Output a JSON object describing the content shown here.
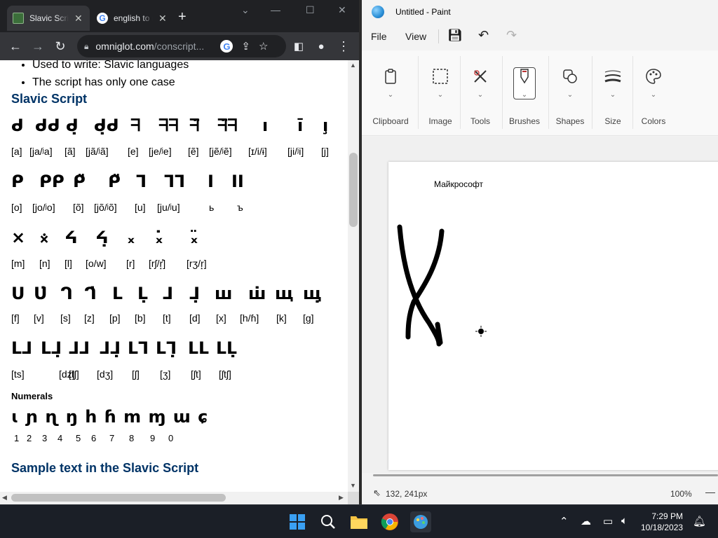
{
  "chrome": {
    "tabs": [
      {
        "label": "Slavic Script",
        "active": true
      },
      {
        "label": "english to russian",
        "active": false
      }
    ],
    "new_tab": "+",
    "window_controls": {
      "minimize": "—",
      "maximize": "☐",
      "close": "✕"
    },
    "url_domain": "omniglot.com",
    "url_path": "/conscript...",
    "icons": [
      "back-icon",
      "forward-icon",
      "reload-icon",
      "lock-icon",
      "google-icon",
      "share-icon",
      "star-icon",
      "sidepanel-icon",
      "profile-icon",
      "menu-icon"
    ]
  },
  "page": {
    "bullets": [
      "Used to write: Slavic languages",
      "The script has only one case"
    ],
    "heading_slavic": "Slavic Script",
    "rows": [
      {
        "glyphs": [
          "ᑯ",
          "ᑯᑯ",
          "ᑯ̣",
          "ᑯ̣ᑯ",
          "ᖷ",
          "ᖷᖷ",
          "ᖷ̈",
          "ᖷ̈ᖷ",
          "ı",
          "ı̄",
          "ı̧"
        ],
        "sounds": [
          "[a]",
          "[ja/ʲa]",
          "[ã]",
          "[jã/ʲã]",
          "[e]",
          "[je/ʲe]",
          "[ẽ]",
          "[jẽ/ʲẽ]",
          "[ɪ/i/ɨ]",
          "[ji/ʲi]",
          "[j]"
        ]
      },
      {
        "glyphs": [
          "ᑭ",
          "ᑭᑭ",
          "ᑭ̈",
          "ᑭ̈",
          "ᒣ",
          "ᒣᒣ",
          "I",
          "II"
        ],
        "sounds": [
          "[o]",
          "[jo/ʲo]",
          "[õ]",
          "[jõ/ʲõ]",
          "[u]",
          "[ju/ʲu]",
          "ь",
          "ъ"
        ]
      },
      {
        "glyphs": [
          "×",
          "⨰",
          "ᔦ",
          "ᔦ̣",
          "᙮",
          "᙮̇",
          "᙮̈"
        ],
        "sounds": [
          "[m]",
          "[n]",
          "[l]",
          "[o/w]",
          "[r]",
          "[rʃ/r̝̊]",
          "[rʒ/r̝]"
        ]
      },
      {
        "glyphs": [
          "ᑌ",
          "ᑌ̇",
          "ᒉ",
          "ᒉ̇",
          "ᒪ",
          "ᒪ̣",
          "ᒧ",
          "ᒧ̣",
          "ш",
          "ш̇",
          "щ",
          "щ̣"
        ],
        "sounds": [
          "[f]",
          "[v]",
          "[s]",
          "[z]",
          "[p]",
          "[b]",
          "[t]",
          "[d]",
          "[x]",
          "[h/ɦ]",
          "[k]",
          "[g]"
        ]
      },
      {
        "glyphs": [
          "ᒪᒧ",
          "ᒪᒧ̣",
          "ᒧᒧ",
          "ᒧᒧ̣",
          "ᒪᒣ",
          "ᒪᒣ̣",
          "ᒪᒪ",
          "ᒪᒪ̣"
        ],
        "sounds": [
          "[ts]",
          "[dz]",
          "[tʃ]",
          "[dʒ]",
          "[ʃ]",
          "[ʒ]",
          "[ʃt]",
          "[ʃtʃ]"
        ]
      }
    ],
    "heading_numerals": "Numerals",
    "numeral_glyphs": "ɩ ɲ ɳ ŋ h ɦ m ɱ ɯ ɕ",
    "numerals": [
      "1",
      "2",
      "3",
      "4",
      "5",
      "6",
      "7",
      "8",
      "9",
      "0"
    ],
    "heading_sample": "Sample text in the Slavic Script"
  },
  "paint": {
    "title": "Untitled - Paint",
    "menu": {
      "file": "File",
      "view": "View"
    },
    "groups": [
      "Clipboard",
      "Image",
      "Tools",
      "Brushes",
      "Shapes",
      "Size",
      "Colors"
    ],
    "canvas_text": "Майкрософт",
    "status": {
      "position": "132, 241px",
      "zoom": "100%"
    }
  },
  "taskbar": {
    "time": "7:29 PM",
    "date": "10/18/2023"
  },
  "colors": {
    "heading": "#003366",
    "taskbar": "#1b1f27",
    "chrome_dark": "#202124"
  }
}
